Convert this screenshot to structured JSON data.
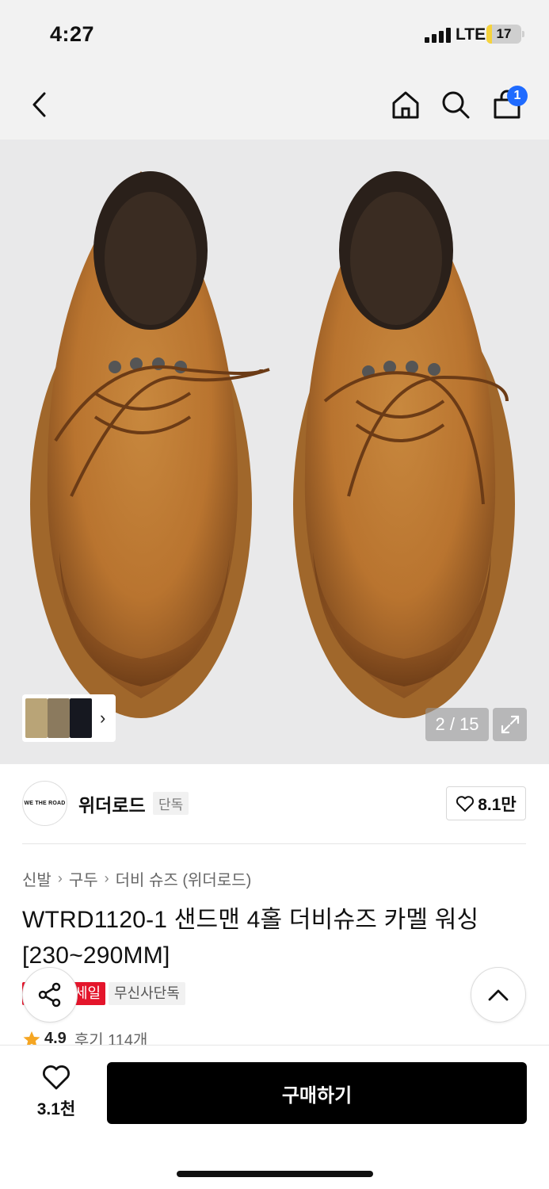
{
  "status_bar": {
    "time": "4:27",
    "network": "LTE",
    "battery": "17",
    "battery_level_percent": 17,
    "battery_color": "#f6d33b"
  },
  "nav": {
    "back_icon": "chevron-left-icon",
    "home_icon": "home-icon",
    "search_icon": "search-icon",
    "cart_icon": "shopping-bag-icon",
    "cart_badge": "1",
    "badge_color": "#1f6bff"
  },
  "gallery": {
    "counter": "2 / 15",
    "expand_icon": "expand-icon",
    "thumbnail_chevron": "›"
  },
  "brand": {
    "logo_text": "WE THE ROAD",
    "name": "위더로드",
    "tag": "단독",
    "likes": "8.1만"
  },
  "breadcrumb": [
    "신발",
    "구두",
    "더비 슈즈 (위더로드)"
  ],
  "product": {
    "title": "WTRD1120-1 샌드맨 4홀 더비슈즈 카멜 워싱 [230~290MM]",
    "badges": {
      "sale": "세일",
      "exclusive": "무신사단독"
    },
    "rating": {
      "score": "4.9",
      "reviews": "후기 114개"
    }
  },
  "bottom_bar": {
    "wish_count": "3.1천",
    "buy_label": "구매하기"
  },
  "colors": {
    "sale_red": "#e4152b",
    "star": "#f5a623",
    "buy_button": "#000000"
  }
}
